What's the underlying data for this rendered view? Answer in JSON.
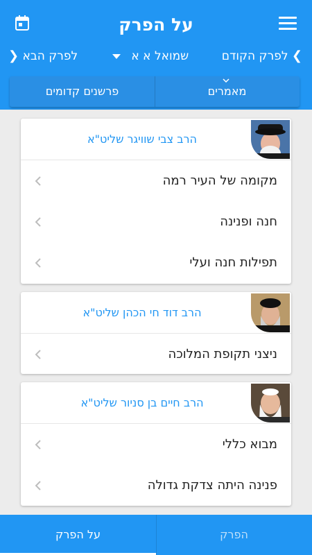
{
  "header": {
    "title": "על הפרק",
    "menu_icon": "hamburger-menu-icon",
    "calendar_icon": "calendar-icon"
  },
  "chapter_nav": {
    "prev_label": "לפרק הקודם",
    "next_label": "לפרק הבא",
    "current": "שמואל א א"
  },
  "tabs": {
    "articles": "מאמרים",
    "early_commentators": "פרשנים קדומים"
  },
  "cards": [
    {
      "rabbi": "הרב צבי שוויגר שליט\"א",
      "items": [
        "מקומה של העיר רמה",
        "חנה ופנינה",
        "תפילות חנה ועלי"
      ]
    },
    {
      "rabbi": "הרב דוד חי הכהן שליט\"א",
      "items": [
        "ניצני תקופת המלוכה"
      ]
    },
    {
      "rabbi": "הרב חיים בן סניור שליט\"א",
      "items": [
        "מבוא כללי",
        "פנינה היתה צדקת גדולה"
      ]
    }
  ],
  "bottom_tabs": {
    "chapter": "הפרק",
    "about_chapter": "על הפרק"
  },
  "colors": {
    "primary": "#2196f3",
    "rabbi_name": "#2196f3",
    "background": "#ececec"
  }
}
